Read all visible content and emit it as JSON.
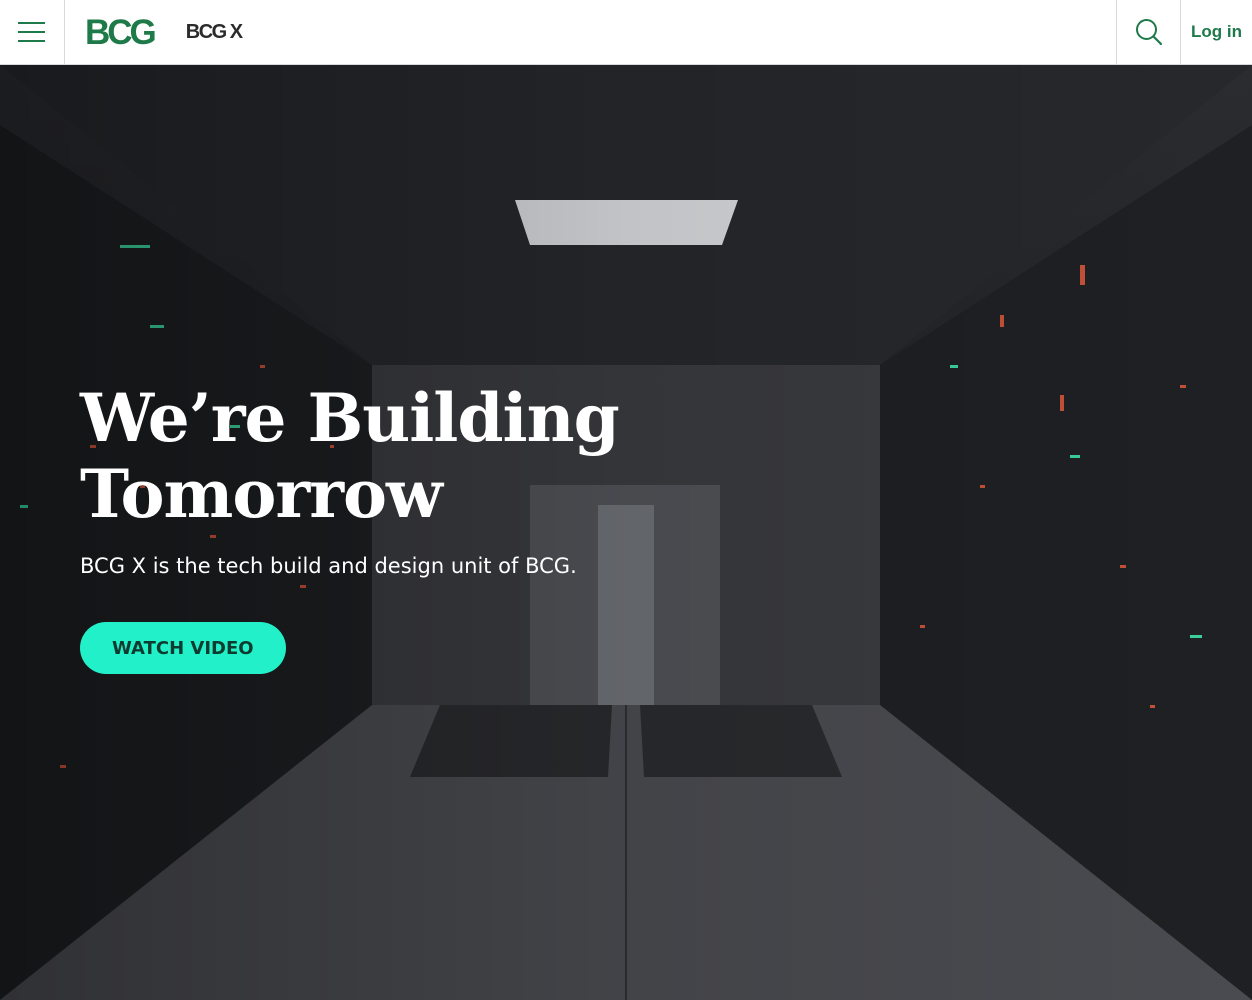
{
  "header": {
    "menu_icon": "hamburger-menu-icon",
    "logo_primary": "BCG",
    "logo_secondary": "BCG X",
    "search_icon": "search-icon",
    "login_label": "Log in"
  },
  "hero": {
    "title_line1": "We’re Building",
    "title_line2": "Tomorrow",
    "subtitle": "BCG X is the tech build and design unit of BCG.",
    "cta_label": "WATCH VIDEO",
    "background": "server-room-corridor-image"
  },
  "colors": {
    "brand_green": "#1f7a4a",
    "cta_background": "#21f0c9",
    "cta_text": "#0e3b30",
    "header_background": "#ffffff"
  }
}
